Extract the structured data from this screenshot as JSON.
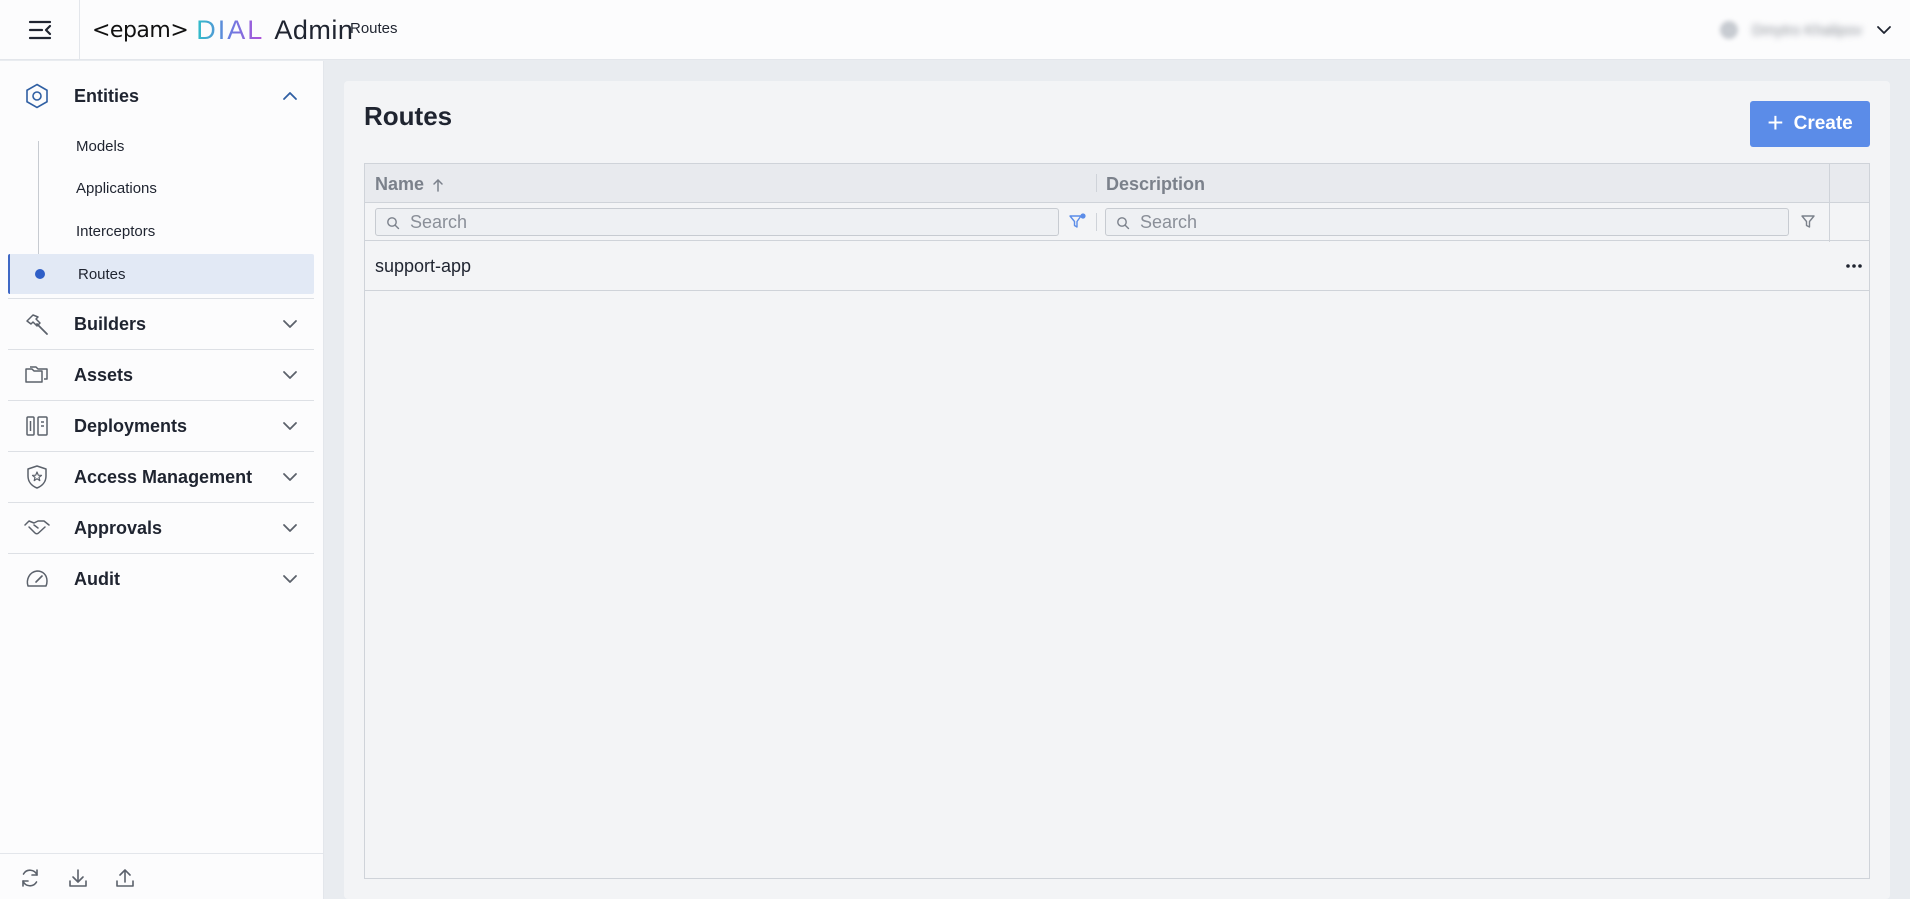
{
  "header": {
    "logo_epam": "<epam>",
    "logo_dial": "DIAL",
    "logo_admin": "Admin",
    "breadcrumb": "Routes",
    "user_name": "Dmytro Khalipov"
  },
  "sidebar": {
    "sections": [
      {
        "label": "Entities",
        "icon": "hexagon-icon",
        "expanded": true
      },
      {
        "label": "Builders",
        "icon": "hammer-icon",
        "expanded": false
      },
      {
        "label": "Assets",
        "icon": "folders-icon",
        "expanded": false
      },
      {
        "label": "Deployments",
        "icon": "deployments-icon",
        "expanded": false
      },
      {
        "label": "Access Management",
        "icon": "shield-star-icon",
        "expanded": false
      },
      {
        "label": "Approvals",
        "icon": "handshake-icon",
        "expanded": false
      },
      {
        "label": "Audit",
        "icon": "gauge-icon",
        "expanded": false
      }
    ],
    "entities_items": [
      {
        "label": "Models",
        "active": false
      },
      {
        "label": "Applications",
        "active": false
      },
      {
        "label": "Interceptors",
        "active": false
      },
      {
        "label": "Routes",
        "active": true
      }
    ],
    "footer_icons": [
      "refresh-icon",
      "download-icon",
      "upload-icon"
    ]
  },
  "main": {
    "title": "Routes",
    "create_label": "Create",
    "columns": [
      {
        "label": "Name",
        "sort": "asc"
      },
      {
        "label": "Description"
      }
    ],
    "filters": [
      {
        "placeholder": "Search",
        "value": "",
        "active": true
      },
      {
        "placeholder": "Search",
        "value": "",
        "active": false
      }
    ],
    "rows": [
      {
        "name": "support-app",
        "description": ""
      }
    ]
  },
  "colors": {
    "accent": "#5b8ce8",
    "active_bg": "#e2e9f5",
    "active_dot": "#2f5fc7"
  }
}
